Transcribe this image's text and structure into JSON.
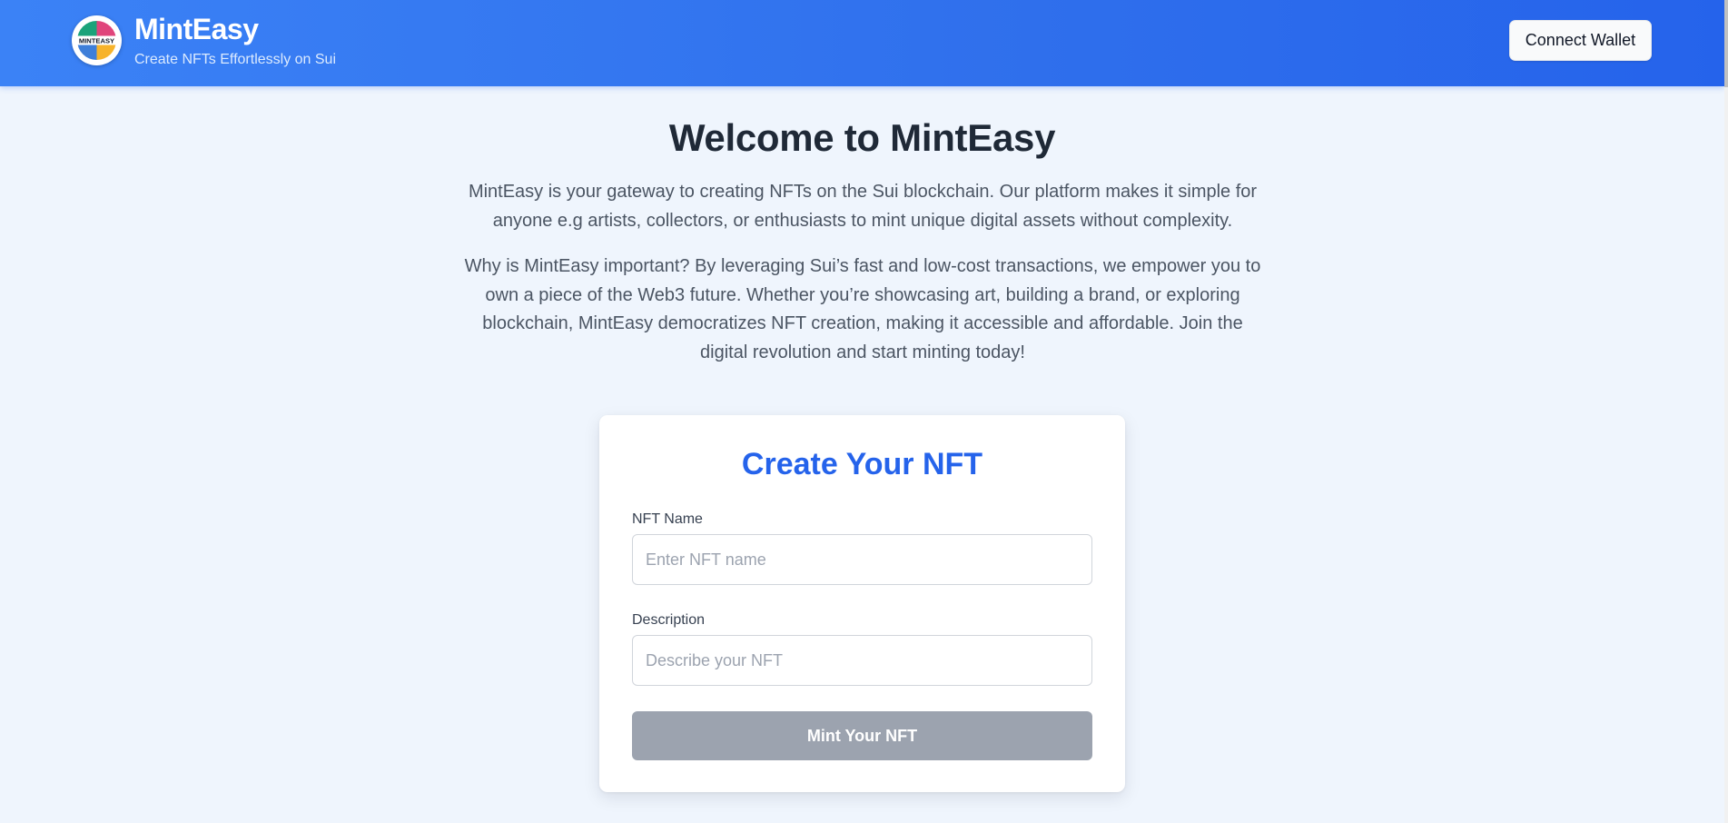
{
  "header": {
    "logo_text": "MINTEASY",
    "title": "MintEasy",
    "subtitle": "Create NFTs Effortlessly on Sui",
    "connect_button": "Connect Wallet"
  },
  "hero": {
    "title": "Welcome to MintEasy",
    "paragraph1": "MintEasy is your gateway to creating NFTs on the Sui blockchain. Our platform makes it simple for anyone e.g artists, collectors, or enthusiasts to mint unique digital assets without complexity.",
    "paragraph2": "Why is MintEasy important? By leveraging Sui’s fast and low-cost transactions, we empower you to own a piece of the Web3 future. Whether you’re showcasing art, building a brand, or exploring blockchain, MintEasy democratizes NFT creation, making it accessible and affordable. Join the digital revolution and start minting today!"
  },
  "form": {
    "title": "Create Your NFT",
    "name_label": "NFT Name",
    "name_placeholder": "Enter NFT name",
    "name_value": "",
    "description_label": "Description",
    "description_placeholder": "Describe your NFT",
    "description_value": "",
    "mint_button": "Mint Your NFT",
    "mint_button_state": "disabled"
  },
  "colors": {
    "header_gradient_start": "#3b82f6",
    "header_gradient_end": "#2563eb",
    "accent": "#2563eb",
    "page_background": "#eff5fd",
    "disabled_button": "#9ca3af",
    "logo_quadrants": [
      "#e0457b",
      "#f7b32b",
      "#3f7fd9",
      "#1aa37a"
    ]
  }
}
